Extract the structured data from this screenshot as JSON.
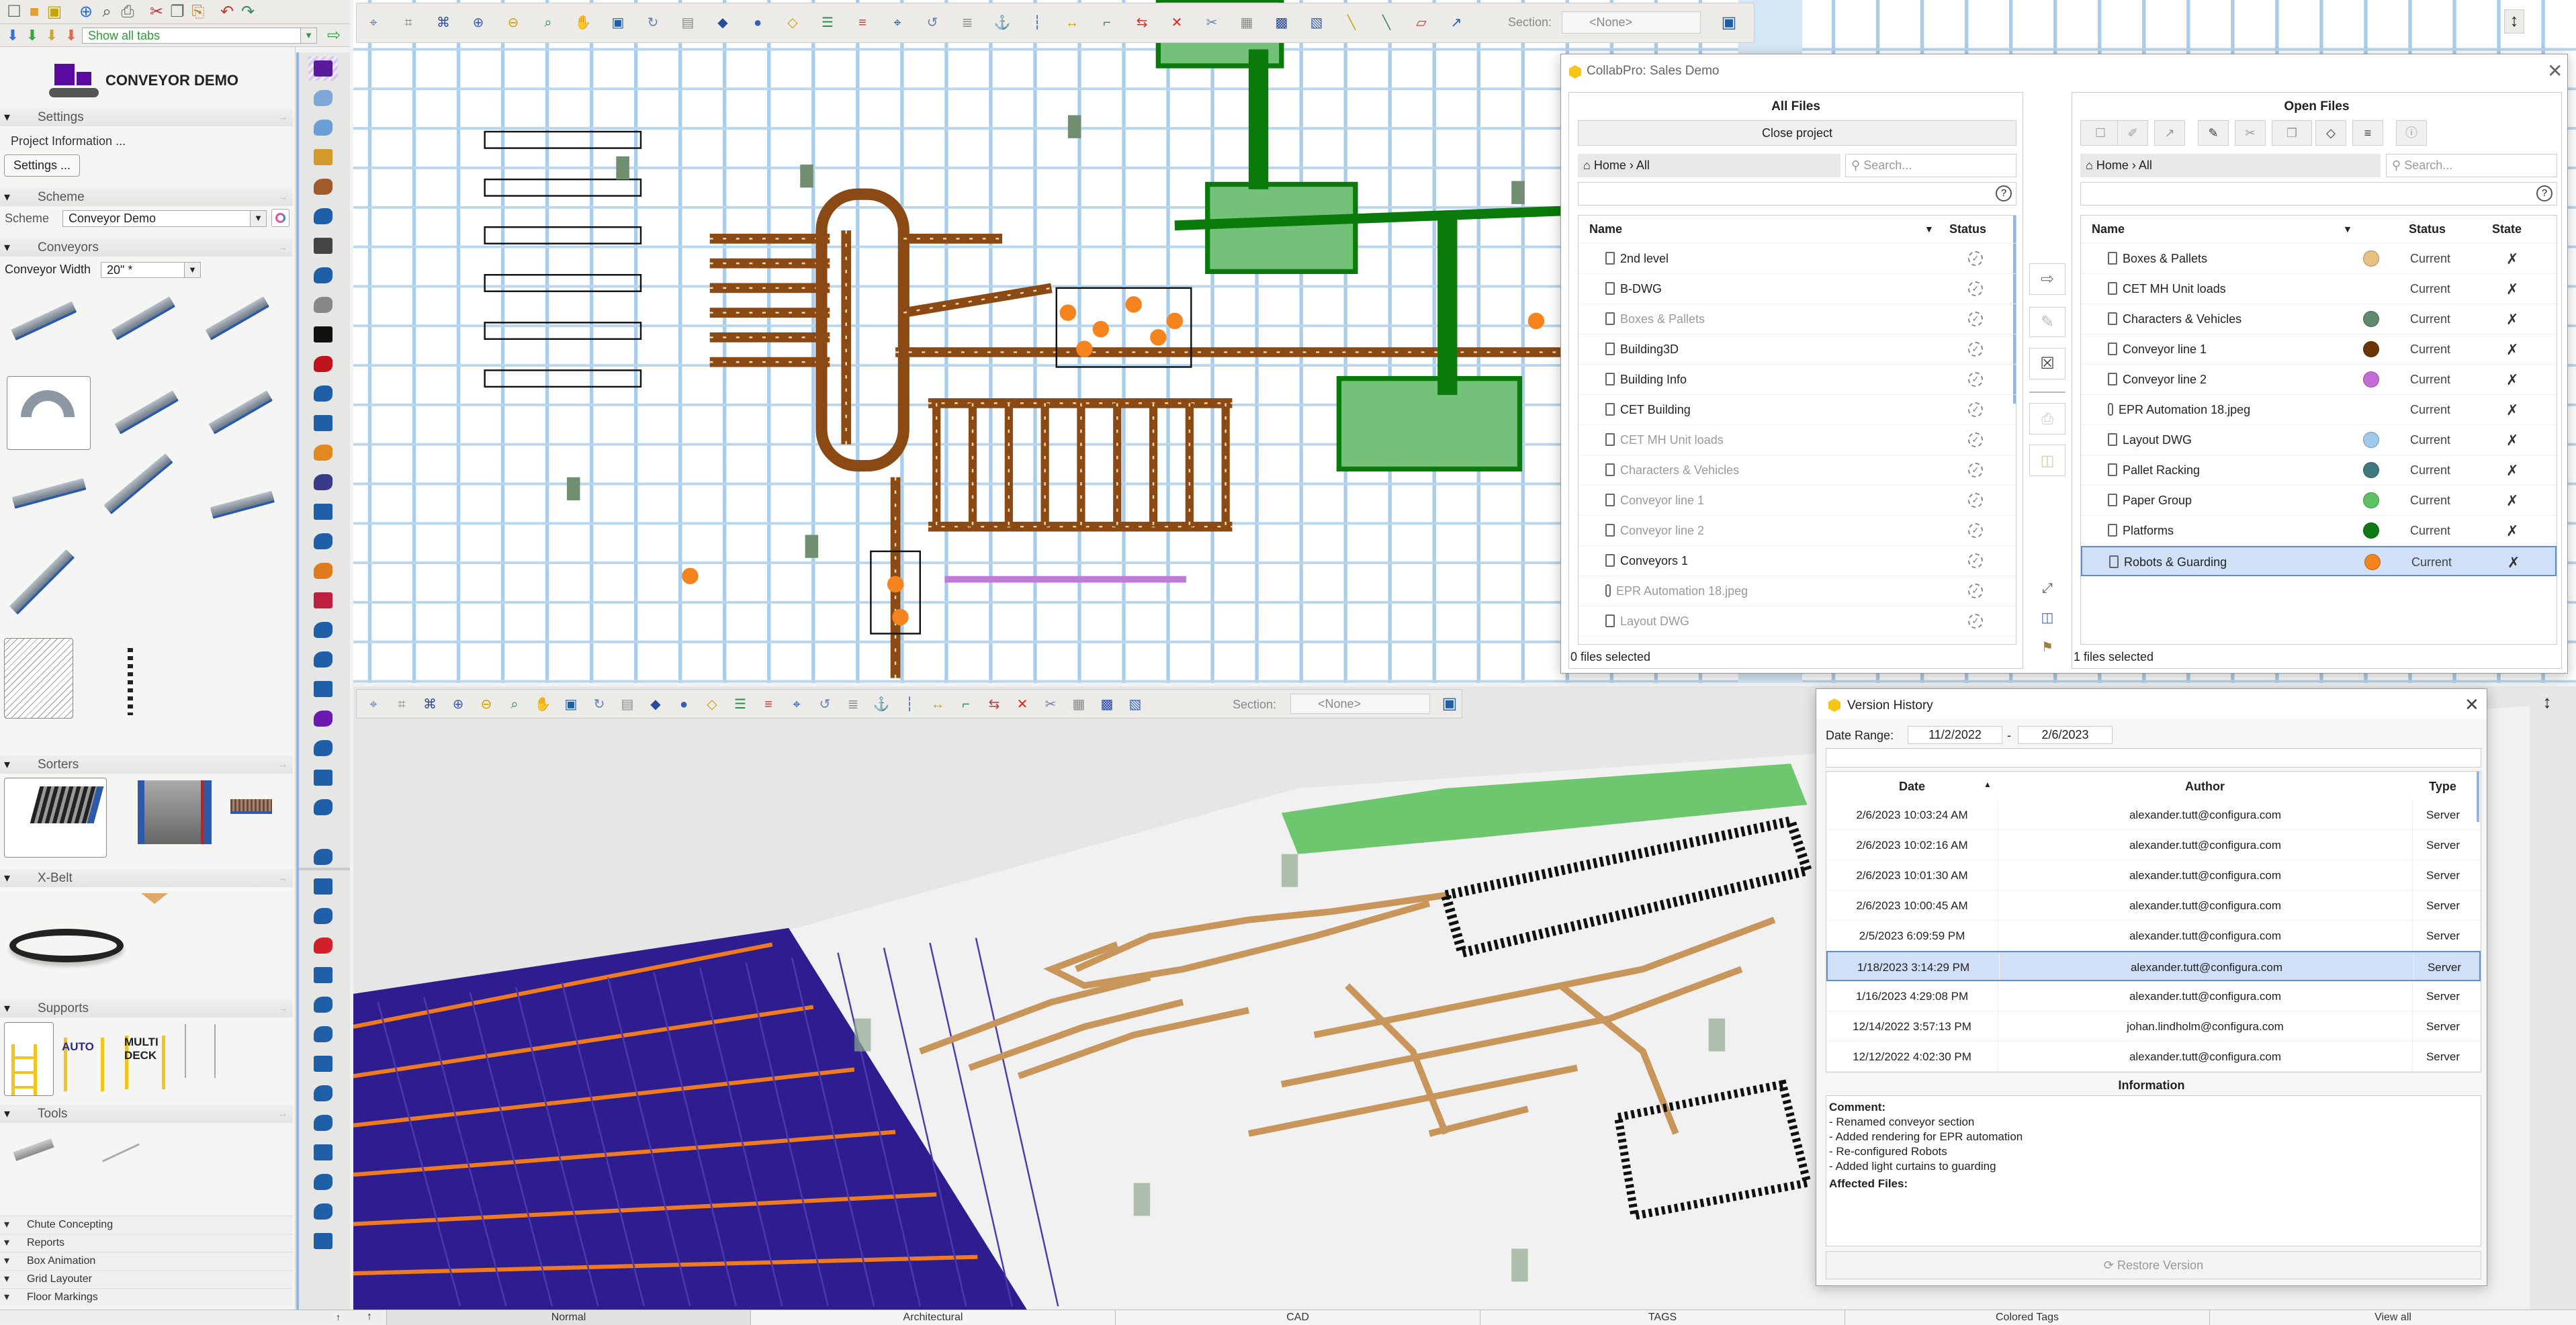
{
  "app_toolbar": {
    "icons": [
      {
        "name": "new-file-icon",
        "glyph": "☐",
        "color": "#666"
      },
      {
        "name": "open-folder-icon",
        "glyph": "■",
        "color": "#e3a02a"
      },
      {
        "name": "save-icon",
        "glyph": "▣",
        "color": "#c9a400"
      },
      {
        "name": "globe-icon",
        "glyph": "⊕",
        "color": "#2a6fd0"
      },
      {
        "name": "print-preview-icon",
        "glyph": "⌕",
        "color": "#555"
      },
      {
        "name": "print-icon",
        "glyph": "⎙",
        "color": "#666"
      },
      {
        "name": "cut-icon",
        "glyph": "✂",
        "color": "#b33"
      },
      {
        "name": "copy-icon",
        "glyph": "❐",
        "color": "#666"
      },
      {
        "name": "paste-icon",
        "glyph": "⎘",
        "color": "#b8862b"
      },
      {
        "name": "undo-icon",
        "glyph": "↶",
        "color": "#c0392b"
      },
      {
        "name": "redo-icon",
        "glyph": "↷",
        "color": "#2e8b57"
      }
    ],
    "arrows": [
      {
        "name": "blue-down-arrow-icon",
        "color": "#3b6fd8"
      },
      {
        "name": "green-down-arrow-icon",
        "color": "#3aa34a"
      },
      {
        "name": "yellow-down-arrow-icon",
        "color": "#c9a83a"
      },
      {
        "name": "red-down-arrow-icon",
        "color": "#d76c4f"
      }
    ],
    "tabs_filter": "Show all tabs"
  },
  "panel": {
    "title": "CONVEYOR DEMO",
    "settings_header": "Settings",
    "project_information": "Project Information ...",
    "settings_button": "Settings ...",
    "scheme_header": "Scheme",
    "scheme_label": "Scheme",
    "scheme_value": "Conveyor Demo",
    "conveyors_header": "Conveyors",
    "conveyor_width_label": "Conveyor Width",
    "conveyor_width_value": "20\" *",
    "sorters_header": "Sorters",
    "xbelt_header": "X-Belt",
    "supports_header": "Supports",
    "supports_auto": "AUTO",
    "supports_multi": "MULTI",
    "supports_deck": "DECK",
    "tools_header": "Tools",
    "collapsed_sections": [
      "Chute Concepting",
      "Reports",
      "Box Animation",
      "Grid Layouter",
      "Floor Markings"
    ]
  },
  "side_icons": [
    {
      "name": "conveyor-demo-icon",
      "color": "#5a1aa0"
    },
    {
      "name": "wall-icon",
      "color": "#7fa8d8"
    },
    {
      "name": "building-icon",
      "color": "#6a9fd8"
    },
    {
      "name": "tools-icon",
      "color": "#d19a2b"
    },
    {
      "name": "materials-icon",
      "color": "#a05a2c"
    },
    {
      "name": "robot-arm-icon",
      "color": "#1f5fa8"
    },
    {
      "name": "stairs-icon",
      "color": "#444"
    },
    {
      "name": "chain-icon",
      "color": "#1f5fa8"
    },
    {
      "name": "rack-icon",
      "color": "#888"
    },
    {
      "name": "tire-icon",
      "color": "#111"
    },
    {
      "name": "linde-icon",
      "color": "#c0141c"
    },
    {
      "name": "rings-icon",
      "color": "#1f5fa8"
    },
    {
      "name": "layers-icon",
      "color": "#1f5fa8"
    },
    {
      "name": "flame-icon",
      "color": "#e08a1e"
    },
    {
      "name": "columns-icon",
      "color": "#3a3a8a"
    },
    {
      "name": "flask-icon",
      "color": "#1f5fa8"
    },
    {
      "name": "reel-icon",
      "color": "#1f5fa8"
    },
    {
      "name": "boxes-icon",
      "color": "#e07a1e"
    },
    {
      "name": "network-icon",
      "color": "#c02040"
    },
    {
      "name": "circles-icon",
      "color": "#1f5fa8"
    },
    {
      "name": "monitor-icon",
      "color": "#1f5fa8"
    },
    {
      "name": "stripes-icon",
      "color": "#1f5fa8"
    },
    {
      "name": "robot-arm-purple-icon",
      "color": "#6a1ab0"
    },
    {
      "name": "bulb-icon",
      "color": "#1f5fa8"
    },
    {
      "name": "people-icon",
      "color": "#1f5fa8"
    },
    {
      "name": "beam-icon",
      "color": "#1f5fa8"
    },
    {
      "name": "kitchen-icon",
      "color": "#1f5fa8"
    },
    {
      "name": "lotus-icon",
      "color": "#1f5fa8"
    },
    {
      "name": "home-heart-icon",
      "color": "#1f5fa8"
    },
    {
      "name": "beta-icon",
      "color": "#d0202a"
    },
    {
      "name": "coffee-icon",
      "color": "#1f5fa8"
    },
    {
      "name": "plug-icon",
      "color": "#1f5fa8"
    },
    {
      "name": "pdf-icon",
      "color": "#1f5fa8"
    },
    {
      "name": "bars-icon",
      "color": "#1f5fa8"
    },
    {
      "name": "hanger-icon",
      "color": "#1f5fa8"
    },
    {
      "name": "wrench-icon",
      "color": "#1f5fa8"
    },
    {
      "name": "clock-icon",
      "color": "#1f5fa8"
    },
    {
      "name": "book-icon",
      "color": "#1f5fa8"
    },
    {
      "name": "history-icon",
      "color": "#1f5fa8"
    },
    {
      "name": "save-blue-icon",
      "color": "#1f5fa8"
    }
  ],
  "viewport_toolbar": {
    "icons": [
      "zoom-window-icon",
      "zoom-prev-icon",
      "zoom-extents-icon",
      "zoom-in-icon",
      "zoom-out-icon",
      "zoom-icon",
      "pan-hand-icon",
      "zoom-selection-icon",
      "refresh-view-icon",
      "view-icon",
      "layers-icon",
      "color-icon",
      "diamond-icon",
      "grid-icon",
      "dims-icon",
      "snap-icon",
      "rotate-icon",
      "list-icon",
      "anchor-icon",
      "align-icon",
      "distribute-icon",
      "measure-icon",
      "spacing-icon",
      "delete-icon",
      "link-icon",
      "frame-icon",
      "film-icon",
      "select-icon",
      "line-icon",
      "line2-icon",
      "ruler-icon",
      "green-measure-icon"
    ],
    "section_label": "Section:",
    "section_value": "<None>"
  },
  "collabpro": {
    "title": "CollabPro: Sales Demo",
    "all_files": {
      "title": "All Files",
      "close_project": "Close project",
      "breadcrumb_home": "Home",
      "breadcrumb_all": "All",
      "search_placeholder": "Search...",
      "col_name": "Name",
      "col_status": "Status",
      "rows": [
        {
          "name": "2nd level",
          "dimmed": false
        },
        {
          "name": "B-DWG",
          "dimmed": false
        },
        {
          "name": "Boxes & Pallets",
          "dimmed": true
        },
        {
          "name": "Building3D",
          "dimmed": false
        },
        {
          "name": "Building Info",
          "dimmed": false
        },
        {
          "name": "CET Building",
          "dimmed": false
        },
        {
          "name": "CET MH Unit loads",
          "dimmed": true
        },
        {
          "name": "Characters & Vehicles",
          "dimmed": true
        },
        {
          "name": "Conveyor line 1",
          "dimmed": true
        },
        {
          "name": "Conveyor line 2",
          "dimmed": true
        },
        {
          "name": "Conveyors 1",
          "dimmed": false
        },
        {
          "name": "EPR Automation 18.jpeg",
          "dimmed": true
        },
        {
          "name": "Layout DWG",
          "dimmed": true
        }
      ],
      "footer": "0 files selected"
    },
    "open_files": {
      "title": "Open Files",
      "breadcrumb_home": "Home",
      "breadcrumb_all": "All",
      "search_placeholder": "Search...",
      "col_name": "Name",
      "col_status": "Status",
      "col_state": "State",
      "rows": [
        {
          "name": "Boxes & Pallets",
          "color": "#e8c07f",
          "status": "Current"
        },
        {
          "name": "CET MH Unit loads",
          "color": "",
          "status": "Current"
        },
        {
          "name": "Characters & Vehicles",
          "color": "#5f8a6e",
          "status": "Current"
        },
        {
          "name": "Conveyor line 1",
          "color": "#6b3506",
          "status": "Current"
        },
        {
          "name": "Conveyor line 2",
          "color": "#c56bd6",
          "status": "Current"
        },
        {
          "name": "EPR Automation 18.jpeg",
          "color": "",
          "status": "Current"
        },
        {
          "name": "Layout DWG",
          "color": "#9ecbec",
          "status": "Current"
        },
        {
          "name": "Pallet Racking",
          "color": "#3f7a7e",
          "status": "Current"
        },
        {
          "name": "Paper Group",
          "color": "#5cc160",
          "status": "Current"
        },
        {
          "name": "Platforms",
          "color": "#0d7a14",
          "status": "Current"
        },
        {
          "name": "Robots & Guarding",
          "color": "#f5841f",
          "status": "Current",
          "selected": true
        }
      ],
      "footer": "1 files selected"
    }
  },
  "version_history": {
    "title": "Version History",
    "date_range_label": "Date Range:",
    "date_from": "11/2/2022",
    "date_sep": "-",
    "date_to": "2/6/2023",
    "col_date": "Date",
    "col_author": "Author",
    "col_type": "Type",
    "rows": [
      {
        "date": "2/6/2023 10:03:24 AM",
        "author": "alexander.tutt@configura.com",
        "type": "Server"
      },
      {
        "date": "2/6/2023 10:02:16 AM",
        "author": "alexander.tutt@configura.com",
        "type": "Server"
      },
      {
        "date": "2/6/2023 10:01:30 AM",
        "author": "alexander.tutt@configura.com",
        "type": "Server"
      },
      {
        "date": "2/6/2023 10:00:45 AM",
        "author": "alexander.tutt@configura.com",
        "type": "Server"
      },
      {
        "date": "2/5/2023 6:09:59 PM",
        "author": "alexander.tutt@configura.com",
        "type": "Server"
      },
      {
        "date": "1/18/2023 3:14:29 PM",
        "author": "alexander.tutt@configura.com",
        "type": "Server",
        "selected": true
      },
      {
        "date": "1/16/2023 4:29:08 PM",
        "author": "alexander.tutt@configura.com",
        "type": "Server"
      },
      {
        "date": "12/14/2022 3:57:13 PM",
        "author": "johan.lindholm@configura.com",
        "type": "Server"
      },
      {
        "date": "12/12/2022 4:02:30 PM",
        "author": "alexander.tutt@configura.com",
        "type": "Server"
      }
    ],
    "information_label": "Information",
    "comment_label": "Comment:",
    "comment_lines": [
      "- Renamed conveyor section",
      "- Added rendering for EPR automation",
      "- Re-configured Robots",
      "- Added light curtains to guarding"
    ],
    "affected_files_label": "Affected Files:",
    "restore_button": "Restore Version"
  },
  "bottom_tabs": [
    "Normal",
    "Architectural",
    "CAD",
    "TAGS",
    "Colored Tags",
    "View all"
  ]
}
